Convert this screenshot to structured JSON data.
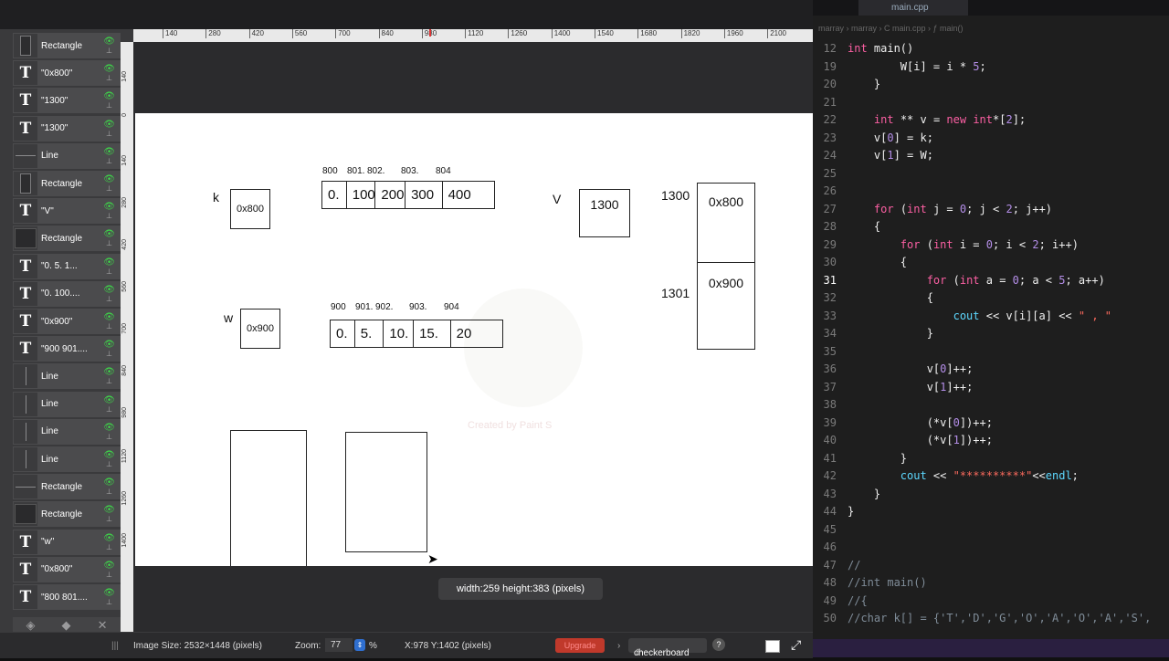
{
  "layers": [
    {
      "kind": "rect",
      "name": "Rectangle"
    },
    {
      "kind": "text",
      "name": "\"0x800\""
    },
    {
      "kind": "text",
      "name": "\"1300\""
    },
    {
      "kind": "text",
      "name": "\"1300\""
    },
    {
      "kind": "line",
      "name": "Line"
    },
    {
      "kind": "rect",
      "name": "Rectangle"
    },
    {
      "kind": "text",
      "name": "\"V\""
    },
    {
      "kind": "rectwide",
      "name": "Rectangle"
    },
    {
      "kind": "text",
      "name": "\"0.     5.     1..."
    },
    {
      "kind": "text",
      "name": "\"0.   100...."
    },
    {
      "kind": "text",
      "name": "\"0x900\""
    },
    {
      "kind": "text",
      "name": "\"900  901...."
    },
    {
      "kind": "vline",
      "name": "Line"
    },
    {
      "kind": "vline",
      "name": "Line"
    },
    {
      "kind": "vline",
      "name": "Line"
    },
    {
      "kind": "vline",
      "name": "Line"
    },
    {
      "kind": "line",
      "name": "Rectangle"
    },
    {
      "kind": "rectwide",
      "name": "Rectangle"
    },
    {
      "kind": "text",
      "name": "\"w\""
    },
    {
      "kind": "text",
      "name": "\"0x800\""
    },
    {
      "kind": "text",
      "name": "\"800  801...."
    }
  ],
  "ruler_h": [
    "140",
    "280",
    "420",
    "560",
    "700",
    "840",
    "980",
    "1120",
    "1260",
    "1400",
    "1540",
    "1680",
    "1820",
    "1960",
    "2100"
  ],
  "ruler_v": [
    "140",
    "0",
    "140",
    "280",
    "420",
    "560",
    "700",
    "840",
    "980",
    "1120",
    "1260",
    "1400"
  ],
  "canvas": {
    "k_label": "k",
    "k_box": "0x800",
    "k_indices": [
      "800",
      "801.",
      "802.",
      "803.",
      "804"
    ],
    "k_cells": [
      "0.",
      "100.",
      "200",
      "300",
      "400"
    ],
    "v_label": "V",
    "v_box": "1300",
    "v_addr_top": "1300",
    "v_addr_bottom": "1301",
    "v_cell_top": "0x800",
    "v_cell_bottom": "0x900",
    "w_label": "w",
    "w_box": "0x900",
    "w_indices": [
      "900",
      "901.",
      "902.",
      "903.",
      "904"
    ],
    "w_cells": [
      "0.",
      "5.",
      "10.",
      "15.",
      "20"
    ],
    "watermark": "Created by Paint S"
  },
  "size_tooltip": "width:259 height:383 (pixels)",
  "status": {
    "image_size": "Image Size: 2532×1448 (pixels)",
    "zoom_label": "Zoom:",
    "zoom_value": "77",
    "zoom_unit": "%",
    "coords": "X:978 Y:1402 (pixels)",
    "upgrade": "Upgrade",
    "background": "checkerboard",
    "help": "?"
  },
  "editor": {
    "tab": "main.cpp",
    "breadcrumb": "marray  ›  marray  ›  C main.cpp  ›  ƒ main()",
    "lines": [
      {
        "n": "12",
        "tokens": [
          [
            "ty",
            "int "
          ],
          [
            "txt",
            "main()"
          ]
        ]
      },
      {
        "n": "19",
        "tokens": [
          [
            "txt",
            "        W[i] = i * "
          ],
          [
            "num",
            "5"
          ],
          [
            "txt",
            ";"
          ]
        ]
      },
      {
        "n": "20",
        "tokens": [
          [
            "txt",
            "    }"
          ]
        ]
      },
      {
        "n": "21",
        "tokens": []
      },
      {
        "n": "22",
        "tokens": [
          [
            "txt",
            "    "
          ],
          [
            "ty",
            "int"
          ],
          [
            "txt",
            " ** v = "
          ],
          [
            "kw",
            "new"
          ],
          [
            "txt",
            " "
          ],
          [
            "ty",
            "int"
          ],
          [
            "txt",
            "*["
          ],
          [
            "num",
            "2"
          ],
          [
            "txt",
            "];"
          ]
        ]
      },
      {
        "n": "23",
        "tokens": [
          [
            "txt",
            "    v["
          ],
          [
            "num",
            "0"
          ],
          [
            "txt",
            "] = k;"
          ]
        ]
      },
      {
        "n": "24",
        "tokens": [
          [
            "txt",
            "    v["
          ],
          [
            "num",
            "1"
          ],
          [
            "txt",
            "] = W;"
          ]
        ]
      },
      {
        "n": "25",
        "tokens": []
      },
      {
        "n": "26",
        "tokens": []
      },
      {
        "n": "27",
        "tokens": [
          [
            "txt",
            "    "
          ],
          [
            "kw",
            "for"
          ],
          [
            "txt",
            " ("
          ],
          [
            "ty",
            "int"
          ],
          [
            "txt",
            " j = "
          ],
          [
            "num",
            "0"
          ],
          [
            "txt",
            "; j < "
          ],
          [
            "num",
            "2"
          ],
          [
            "txt",
            "; j++)"
          ]
        ]
      },
      {
        "n": "28",
        "tokens": [
          [
            "txt",
            "    {"
          ]
        ]
      },
      {
        "n": "29",
        "tokens": [
          [
            "txt",
            "        "
          ],
          [
            "kw",
            "for"
          ],
          [
            "txt",
            " ("
          ],
          [
            "ty",
            "int"
          ],
          [
            "txt",
            " i = "
          ],
          [
            "num",
            "0"
          ],
          [
            "txt",
            "; i < "
          ],
          [
            "num",
            "2"
          ],
          [
            "txt",
            "; i++)"
          ]
        ]
      },
      {
        "n": "30",
        "tokens": [
          [
            "txt",
            "        {"
          ]
        ]
      },
      {
        "n": "31",
        "tokens": [
          [
            "txt",
            "            "
          ],
          [
            "kw",
            "for"
          ],
          [
            "txt",
            " ("
          ],
          [
            "ty",
            "int"
          ],
          [
            "txt",
            " a = "
          ],
          [
            "num",
            "0"
          ],
          [
            "txt",
            "; a < "
          ],
          [
            "num",
            "5"
          ],
          [
            "txt",
            "; a++)"
          ]
        ],
        "current": true
      },
      {
        "n": "32",
        "tokens": [
          [
            "txt",
            "            {"
          ]
        ]
      },
      {
        "n": "33",
        "tokens": [
          [
            "txt",
            "                "
          ],
          [
            "fn",
            "cout"
          ],
          [
            "txt",
            " << v[i][a] << "
          ],
          [
            "str",
            "\" , \""
          ]
        ]
      },
      {
        "n": "34",
        "tokens": [
          [
            "txt",
            "            }"
          ]
        ]
      },
      {
        "n": "35",
        "tokens": []
      },
      {
        "n": "36",
        "tokens": [
          [
            "txt",
            "            v["
          ],
          [
            "num",
            "0"
          ],
          [
            "txt",
            "]++;"
          ]
        ]
      },
      {
        "n": "37",
        "tokens": [
          [
            "txt",
            "            v["
          ],
          [
            "num",
            "1"
          ],
          [
            "txt",
            "]++;"
          ]
        ]
      },
      {
        "n": "38",
        "tokens": []
      },
      {
        "n": "39",
        "tokens": [
          [
            "txt",
            "            (*v["
          ],
          [
            "num",
            "0"
          ],
          [
            "txt",
            "])++;"
          ]
        ]
      },
      {
        "n": "40",
        "tokens": [
          [
            "txt",
            "            (*v["
          ],
          [
            "num",
            "1"
          ],
          [
            "txt",
            "])++;"
          ]
        ]
      },
      {
        "n": "41",
        "tokens": [
          [
            "txt",
            "        }"
          ]
        ]
      },
      {
        "n": "42",
        "tokens": [
          [
            "txt",
            "        "
          ],
          [
            "fn",
            "cout"
          ],
          [
            "txt",
            " << "
          ],
          [
            "str",
            "\"**********\""
          ],
          [
            "txt",
            "<<"
          ],
          [
            "fn",
            "endl"
          ],
          [
            "txt",
            ";"
          ]
        ]
      },
      {
        "n": "43",
        "tokens": [
          [
            "txt",
            "    }"
          ]
        ]
      },
      {
        "n": "44",
        "tokens": [
          [
            "txt",
            "}"
          ]
        ]
      },
      {
        "n": "45",
        "tokens": []
      },
      {
        "n": "46",
        "tokens": []
      },
      {
        "n": "47",
        "tokens": [
          [
            "cm",
            "//"
          ]
        ]
      },
      {
        "n": "48",
        "tokens": [
          [
            "cm",
            "//int main()"
          ]
        ]
      },
      {
        "n": "49",
        "tokens": [
          [
            "cm",
            "//{"
          ]
        ]
      },
      {
        "n": "50",
        "tokens": [
          [
            "cm",
            "//char k[] = {'T','D','G','O','A','O','A','S',"
          ]
        ]
      }
    ]
  }
}
